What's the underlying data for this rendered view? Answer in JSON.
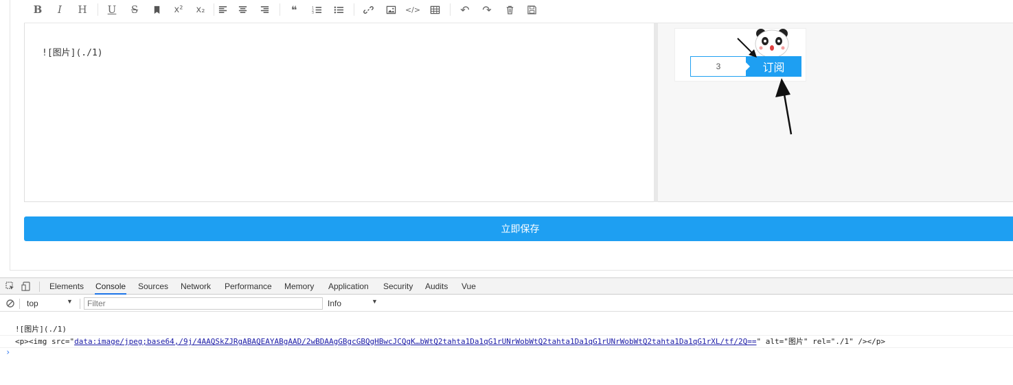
{
  "toolbar": {
    "buttons": [
      {
        "name": "bold",
        "glyph": "B"
      },
      {
        "name": "italic",
        "glyph": "I"
      },
      {
        "name": "heading",
        "glyph": "H"
      },
      {
        "name": "underline",
        "glyph": "U"
      },
      {
        "name": "strikethrough",
        "glyph": "S"
      },
      {
        "name": "bookmark",
        "glyph": ""
      },
      {
        "name": "superscript",
        "glyph": "x²"
      },
      {
        "name": "subscript",
        "glyph": "x₂"
      },
      {
        "name": "align-left",
        "glyph": ""
      },
      {
        "name": "align-center",
        "glyph": ""
      },
      {
        "name": "align-right",
        "glyph": ""
      },
      {
        "name": "quote",
        "glyph": "❝"
      },
      {
        "name": "ordered-list",
        "glyph": ""
      },
      {
        "name": "unordered-list",
        "glyph": ""
      },
      {
        "name": "link",
        "glyph": ""
      },
      {
        "name": "image",
        "glyph": ""
      },
      {
        "name": "code",
        "glyph": "</>"
      },
      {
        "name": "table",
        "glyph": ""
      },
      {
        "name": "undo",
        "glyph": "↶"
      },
      {
        "name": "redo",
        "glyph": "↷"
      },
      {
        "name": "trash",
        "glyph": ""
      },
      {
        "name": "save",
        "glyph": ""
      }
    ]
  },
  "editor": {
    "content": "![图片](./1)"
  },
  "preview": {
    "widget_input_value": "3",
    "widget_button_label": "订阅"
  },
  "save_button": {
    "label": "立即保存"
  },
  "devtools": {
    "tabs": [
      "Elements",
      "Console",
      "Sources",
      "Network",
      "Performance",
      "Memory",
      "Application",
      "Security",
      "Audits",
      "Vue"
    ],
    "active_tab": "Console",
    "context": "top",
    "filter_placeholder": "Filter",
    "level": "Info",
    "console_lines": {
      "line1": "![图片](./1)",
      "line2_prefix": "<p><img src=\"",
      "line2_link": "data:image/jpeg;base64,/9j/4AAQSkZJRgABAQEAYABgAAD/2wBDAAgGBgcGBQgHBwcJCQgK…bWtQ2tahta1Da1qG1rUNrWobWtQ2tahta1Da1qG1rUNrWobWtQ2tahta1Da1qG1rXL/tf/2Q==",
      "line2_suffix": "\" alt=\"图片\" rel=\"./1\" /></p>"
    },
    "prompt": "›"
  }
}
